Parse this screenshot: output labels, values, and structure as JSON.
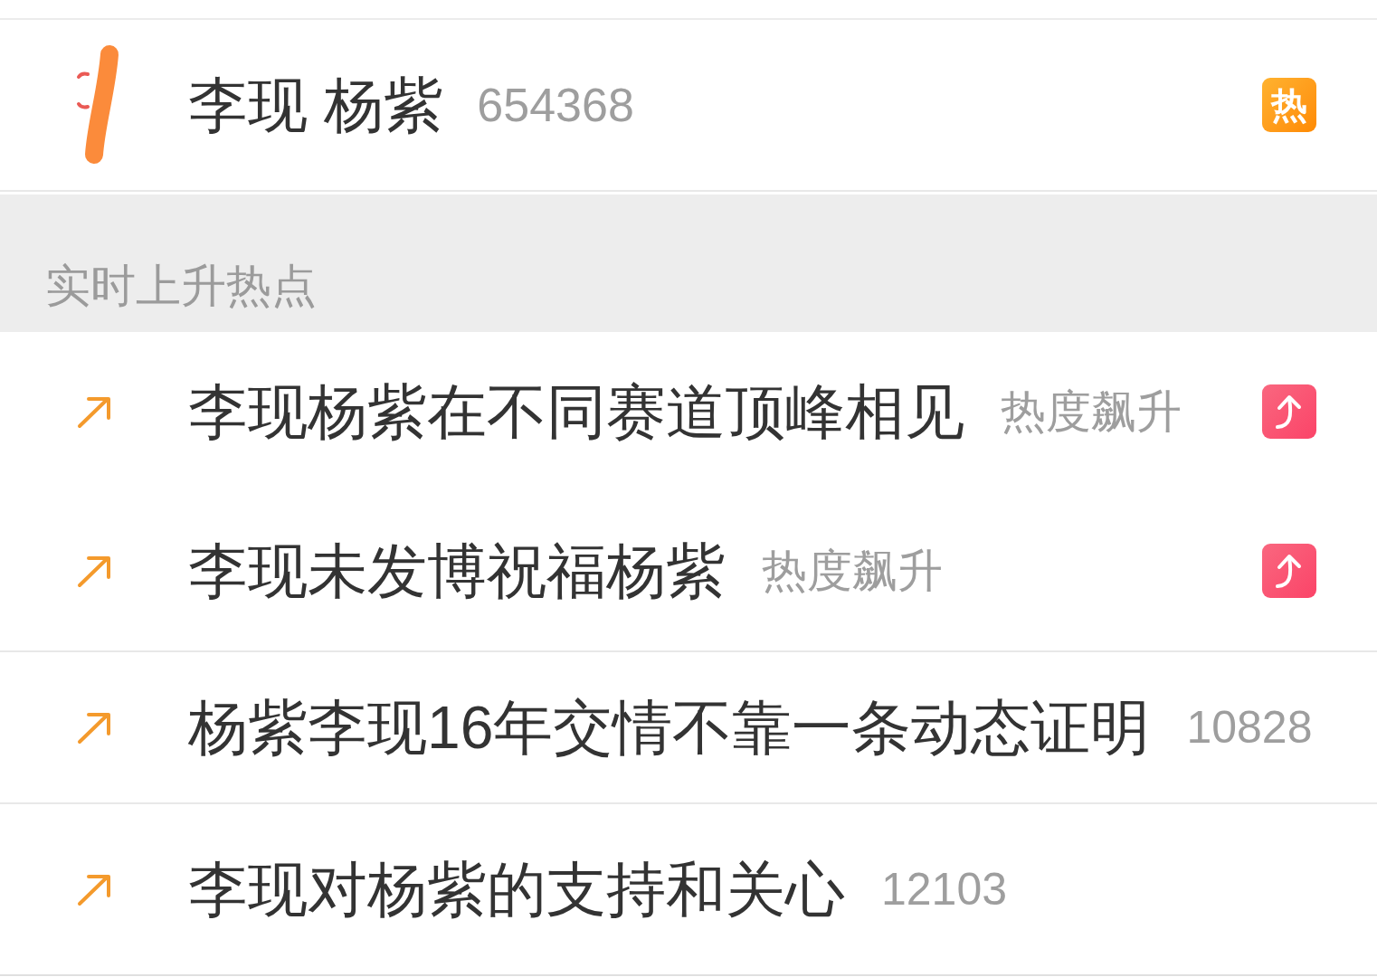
{
  "pinned_topic": {
    "title": "李现 杨紫",
    "heat": "654368",
    "badge": {
      "kind": "hot",
      "text": "热"
    }
  },
  "section_title": "实时上升热点",
  "row_groups": [
    {
      "rows": [
        {
          "title": "李现杨紫在不同赛道顶峰相见",
          "heat": "热度飙升",
          "badge": {
            "kind": "rising"
          }
        },
        {
          "title": "李现未发博祝福杨紫",
          "heat": "热度飙升",
          "badge": {
            "kind": "rising"
          }
        }
      ]
    },
    {
      "rows": [
        {
          "title": "杨紫李现16年交情不靠一条动态证明",
          "heat": "10828"
        }
      ]
    },
    {
      "rows": [
        {
          "title": "李现对杨紫的支持和关心",
          "heat": "12103"
        }
      ]
    }
  ]
}
